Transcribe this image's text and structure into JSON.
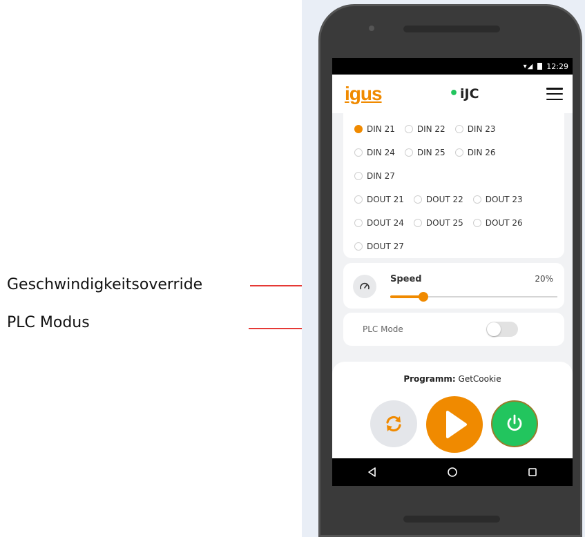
{
  "callouts": [
    {
      "label": "Geschwindigkeitsoverride"
    },
    {
      "label": "PLC Modus"
    }
  ],
  "status_bar": {
    "time": "12:29",
    "icons": [
      "wifi-icon",
      "signal-icon",
      "battery-icon"
    ]
  },
  "app_bar": {
    "logo": "igus",
    "brand": "iJC",
    "menu_icon": "hamburger-menu-icon"
  },
  "io_options": {
    "rows": [
      [
        "DIN 21",
        "DIN 22",
        "DIN 23"
      ],
      [
        "DIN 24",
        "DIN 25",
        "DIN 26"
      ],
      [
        "DIN 27"
      ],
      [
        "DOUT 21",
        "DOUT 22",
        "DOUT 23"
      ],
      [
        "DOUT 24",
        "DOUT 25",
        "DOUT 26"
      ],
      [
        "DOUT 27"
      ]
    ],
    "selected": "DIN 21"
  },
  "speed": {
    "title": "Speed",
    "value_label": "20%",
    "value": 0.2,
    "icon": "speedometer-icon"
  },
  "plc": {
    "label": "PLC Mode",
    "enabled": false
  },
  "program": {
    "prefix": "Programm:",
    "name": "GetCookie"
  },
  "controls": {
    "reload_icon": "sync-icon",
    "play_icon": "play-icon",
    "power_icon": "power-icon"
  },
  "nav": {
    "back_icon": "back-triangle-icon",
    "home_icon": "home-circle-icon",
    "recents_icon": "recents-square-icon"
  },
  "colors": {
    "accent": "#f08a00",
    "success": "#22c55e",
    "arrow": "#e53935"
  }
}
